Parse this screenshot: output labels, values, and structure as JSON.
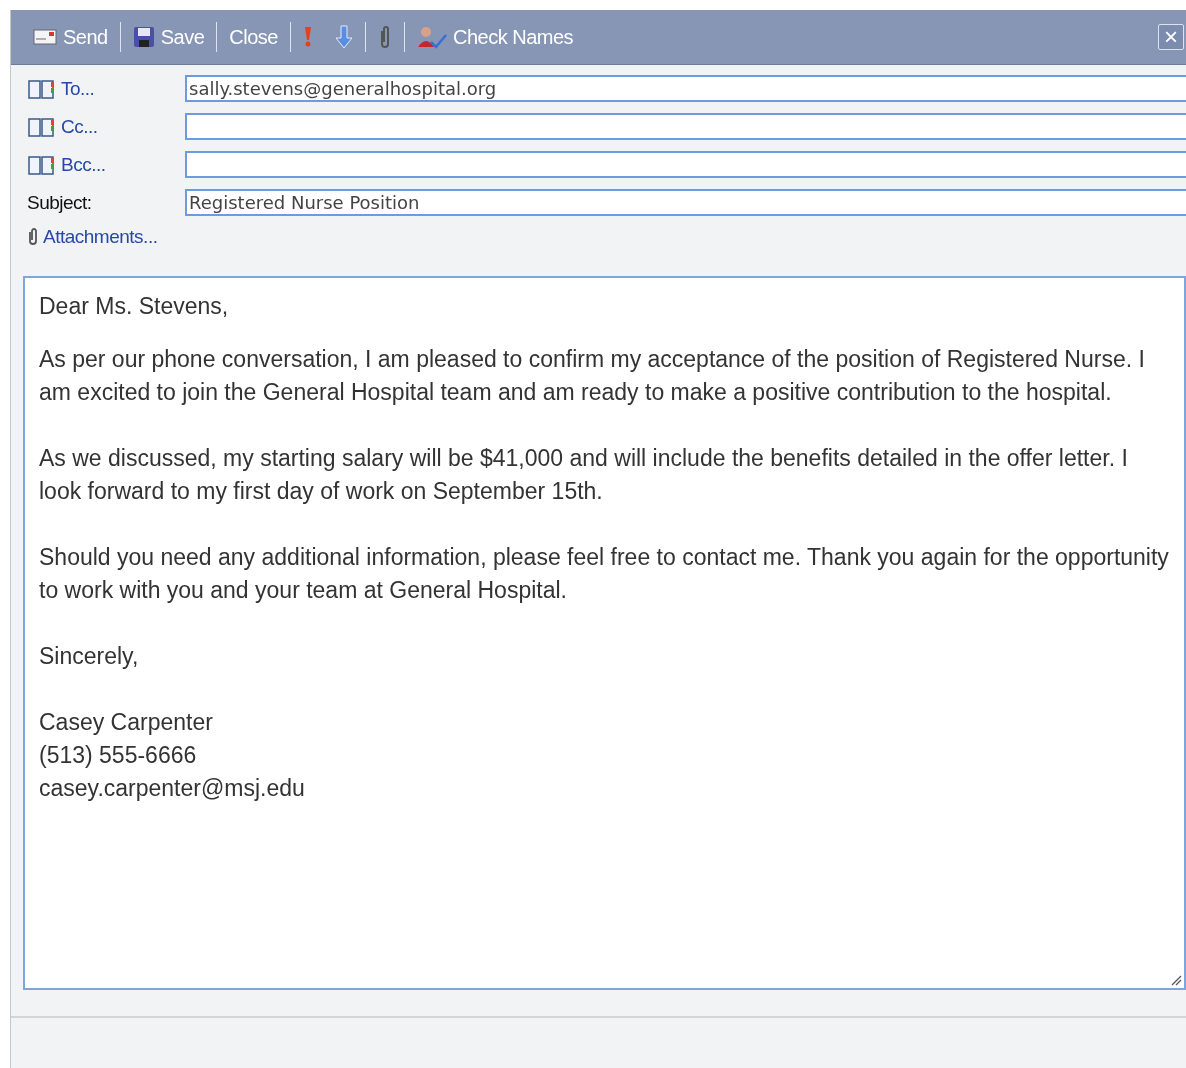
{
  "toolbar": {
    "groups": [
      [
        {
          "kind": "send",
          "label": "Send"
        }
      ],
      [
        {
          "kind": "save",
          "label": "Save"
        }
      ],
      [
        {
          "kind": "text",
          "label": "Close"
        }
      ],
      [
        {
          "kind": "importance"
        },
        {
          "kind": "low_importance"
        }
      ],
      [
        {
          "kind": "attach"
        }
      ],
      [
        {
          "kind": "check_names",
          "label": "Check Names"
        }
      ]
    ],
    "close_button": "×"
  },
  "address_fields": [
    {
      "kind": "book",
      "label": "To...",
      "value": "sally.stevens@generalhospital.org"
    },
    {
      "kind": "book",
      "label": "Cc..."
    },
    {
      "kind": "book",
      "label": "Bcc..."
    },
    {
      "kind": "plain",
      "label": "Subject:",
      "value": "Registered Nurse Position"
    }
  ],
  "attachments": {
    "label": "Attachments..."
  },
  "body": {
    "paragraphs": [
      {
        "lines": [
          "Dear Ms. Stevens,"
        ]
      },
      {
        "lines": [
          "As per our phone conversation, I am pleased to confirm my acceptance of the position of Registered Nurse.  I am excited to join the General Hospital team and am ready to make a positive contribution to the hospital."
        ]
      },
      {
        "lines": [
          "As we discussed, my starting salary will be $41,000 and will include the benefits detailed in the offer letter.  I look forward to my first day of work on September 15th."
        ]
      },
      {
        "lines": [
          "Should you need any additional information, please feel free to contact me. Thank you again for the opportunity to work with you and your team at General Hospital."
        ]
      },
      {
        "lines": [
          "Sincerely,"
        ]
      },
      {
        "lines": [
          "Casey Carpenter",
          "(513) 555-6666",
          "casey.carpenter@msj.edu"
        ]
      }
    ]
  }
}
